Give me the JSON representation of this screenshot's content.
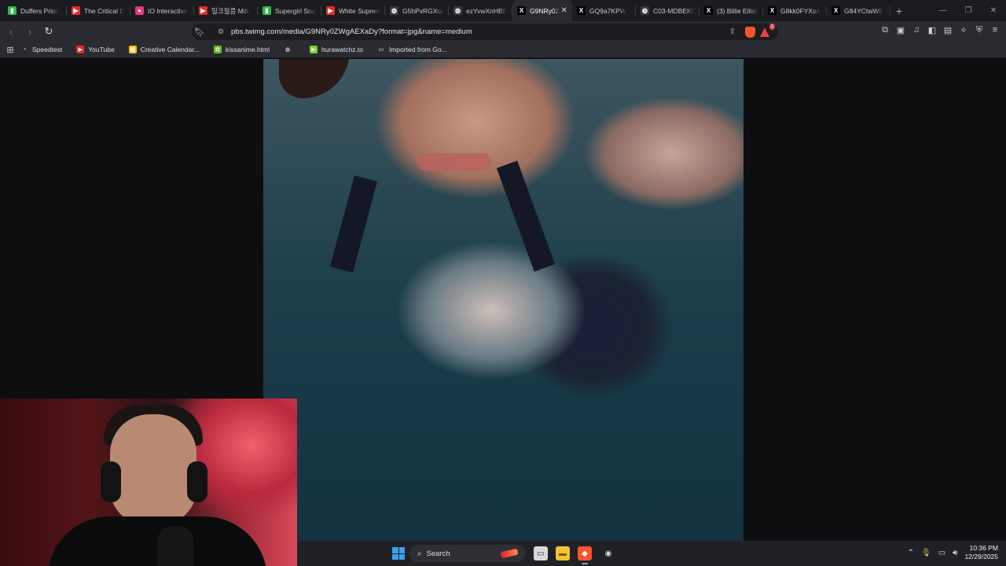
{
  "tabs": [
    {
      "title": "Duffers Priori",
      "icon": "green-square-icon",
      "color": "#2cbb4d"
    },
    {
      "title": "The Critical D",
      "icon": "youtube-icon",
      "color": "#e32b2b"
    },
    {
      "title": "IO Interactive",
      "icon": "io-icon",
      "color": "#e8367a"
    },
    {
      "title": "밀크필름 Milk",
      "icon": "youtube-icon",
      "color": "#e32b2b"
    },
    {
      "title": "Supergirl Sna",
      "icon": "green-square-icon",
      "color": "#2cbb4d"
    },
    {
      "title": "White Suprem",
      "icon": "youtube-icon",
      "color": "#e32b2b"
    },
    {
      "title": "G5hPvRGXoA",
      "icon": "globe-icon",
      "color": "#3a3b41"
    },
    {
      "title": "ezYvwXnHB5",
      "icon": "globe-icon",
      "color": "#3a3b41"
    },
    {
      "title": "G9NRy0Z",
      "icon": "x-logo-icon",
      "color": "#000000",
      "active": true
    },
    {
      "title": "GQ9a7KPW",
      "icon": "x-logo-icon",
      "color": "#000000"
    },
    {
      "title": "C03-MDBEK5",
      "icon": "globe-icon",
      "color": "#3a3b41"
    },
    {
      "title": "(3) Billie Eilish",
      "icon": "x-logo-icon",
      "color": "#000000"
    },
    {
      "title": "G8kk0FYXsA",
      "icon": "x-logo-icon",
      "color": "#000000"
    },
    {
      "title": "G84YCtwWE",
      "icon": "x-logo-icon",
      "color": "#000000"
    }
  ],
  "address_bar": {
    "url": "pbs.twimg.com/media/G9NRy0ZWgAEXaDy?format=jpg&name=medium",
    "rewards_badge": "1"
  },
  "bookmarks": [
    {
      "label": "Speedtest",
      "icon": "speedtest-icon",
      "color": "#2a2b31"
    },
    {
      "label": "YouTube",
      "icon": "youtube-icon",
      "color": "#e32b2b"
    },
    {
      "label": "Creative Calendar...",
      "icon": "calendar-icon",
      "color": "#f2c21b"
    },
    {
      "label": "kissanime.html",
      "icon": "kissanime-icon",
      "color": "#6cbb2a"
    },
    {
      "label": "",
      "icon": "globe-icon",
      "color": "#2a2b31"
    },
    {
      "label": "hurawatchz.to",
      "icon": "hurawatch-icon",
      "color": "#7ad030"
    },
    {
      "label": "Imported from Go...",
      "icon": "folder-icon",
      "color": "#2a2b31"
    }
  ],
  "taskbar": {
    "search_label": "Search",
    "time": "10:36 PM",
    "date": "12/29/2025"
  }
}
